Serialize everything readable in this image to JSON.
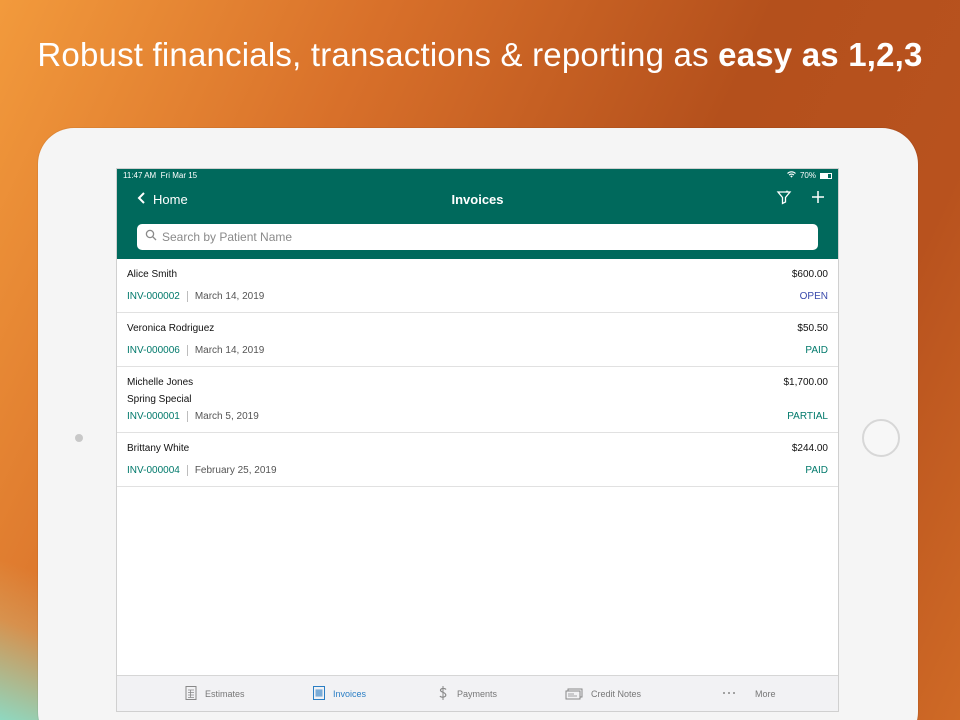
{
  "headline": {
    "regular": "Robust financials, transactions & reporting as ",
    "bold": "easy as 1,2,3"
  },
  "status": {
    "time": "11:47 AM",
    "date": "Fri Mar 15",
    "battery": "70%"
  },
  "nav": {
    "back_label": "Home",
    "title": "Invoices"
  },
  "search": {
    "placeholder": "Search by Patient Name"
  },
  "invoices": [
    {
      "name": "Alice Smith",
      "subtitle": "",
      "amount": "$600.00",
      "number": "INV-000002",
      "date": "March 14, 2019",
      "status": "OPEN"
    },
    {
      "name": "Veronica Rodriguez",
      "subtitle": "",
      "amount": "$50.50",
      "number": "INV-000006",
      "date": "March 14, 2019",
      "status": "PAID"
    },
    {
      "name": "Michelle Jones",
      "subtitle": "Spring Special",
      "amount": "$1,700.00",
      "number": "INV-000001",
      "date": "March 5, 2019",
      "status": "PARTIAL"
    },
    {
      "name": "Brittany White",
      "subtitle": "",
      "amount": "$244.00",
      "number": "INV-000004",
      "date": "February 25, 2019",
      "status": "PAID"
    }
  ],
  "tabs": [
    {
      "label": "Estimates",
      "icon": "estimates-icon",
      "active": false
    },
    {
      "label": "Invoices",
      "icon": "invoices-icon",
      "active": true
    },
    {
      "label": "Payments",
      "icon": "dollar-icon",
      "active": false
    },
    {
      "label": "Credit Notes",
      "icon": "credit-notes-icon",
      "active": false
    },
    {
      "label": "More",
      "icon": "more-icon",
      "active": false
    }
  ],
  "colors": {
    "header": "#00695c",
    "accent": "#00796b",
    "open": "#3949ab",
    "active_tab": "#2a7ec4"
  }
}
